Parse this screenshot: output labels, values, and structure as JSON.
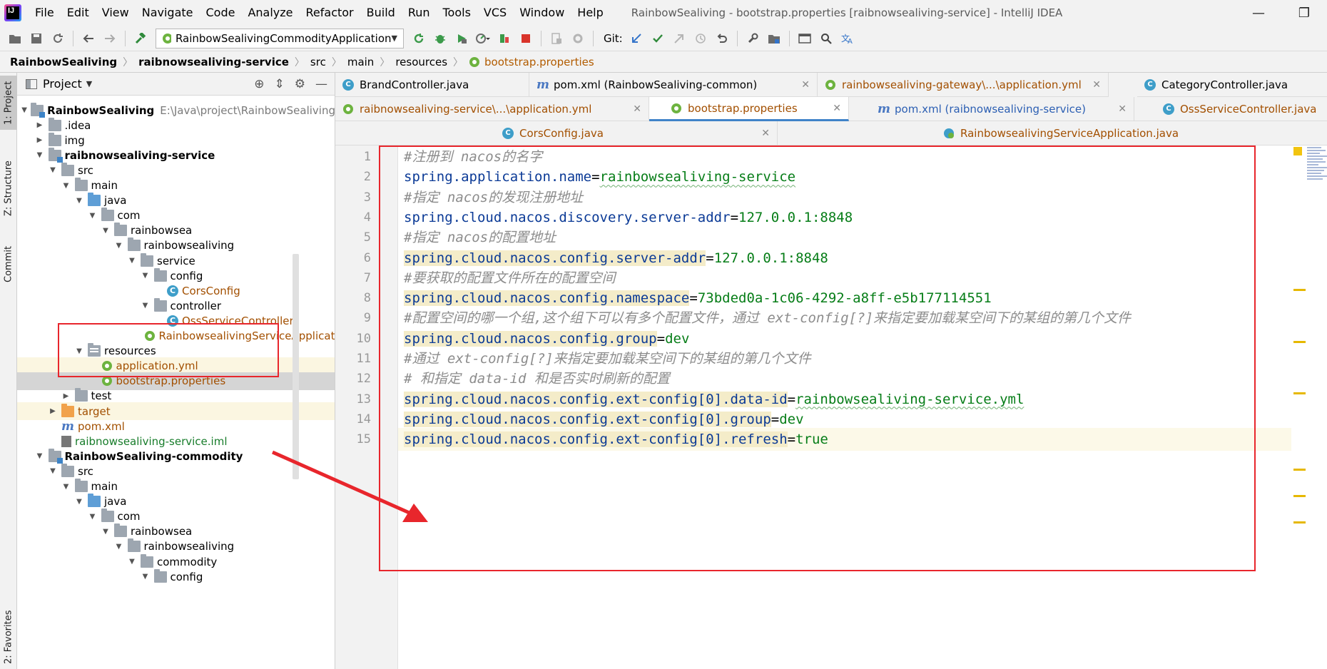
{
  "menu": {
    "items": [
      "File",
      "Edit",
      "View",
      "Navigate",
      "Code",
      "Analyze",
      "Refactor",
      "Build",
      "Run",
      "Tools",
      "VCS",
      "Window",
      "Help"
    ],
    "window_title": "RainbowSealiving - bootstrap.properties [raibnowsealiving-service] - IntelliJ IDEA",
    "minimize": "—",
    "restore": "❐"
  },
  "toolbar": {
    "run_config": "RainbowSealivingCommodityApplication",
    "git_label": "Git:"
  },
  "breadcrumb": {
    "items": [
      "RainbowSealiving",
      "raibnowsealiving-service",
      "src",
      "main",
      "resources",
      "bootstrap.properties"
    ]
  },
  "stripe": {
    "project": "1: Project",
    "structure": "Z: Structure",
    "commit": "Commit",
    "favorites": "2: Favorites"
  },
  "project_panel": {
    "title": "Project",
    "tree": [
      {
        "label": "RainbowSealiving",
        "path": "E:\\Java\\project\\RainbowSealiving"
      },
      {
        "label": ".idea"
      },
      {
        "label": "img"
      },
      {
        "label": "raibnowsealiving-service"
      },
      {
        "label": "src"
      },
      {
        "label": "main"
      },
      {
        "label": "java"
      },
      {
        "label": "com"
      },
      {
        "label": "rainbowsea"
      },
      {
        "label": "rainbowsealiving"
      },
      {
        "label": "service"
      },
      {
        "label": "config"
      },
      {
        "label": "CorsConfig"
      },
      {
        "label": "controller"
      },
      {
        "label": "OssServiceController"
      },
      {
        "label": "RainbowsealivingServiceApplication"
      },
      {
        "label": "resources"
      },
      {
        "label": "application.yml"
      },
      {
        "label": "bootstrap.properties"
      },
      {
        "label": "test"
      },
      {
        "label": "target"
      },
      {
        "label": "pom.xml"
      },
      {
        "label": "raibnowsealiving-service.iml"
      },
      {
        "label": "RainbowSealiving-commodity"
      },
      {
        "label": "src"
      },
      {
        "label": "main"
      },
      {
        "label": "java"
      },
      {
        "label": "com"
      },
      {
        "label": "rainbowsea"
      },
      {
        "label": "rainbowsealiving"
      },
      {
        "label": "commodity"
      },
      {
        "label": "config"
      }
    ]
  },
  "tabs": {
    "row1": [
      "BrandController.java",
      "pom.xml (RainbowSealiving-common)",
      "rainbowsealiving-gateway\\...\\application.yml",
      "CategoryController.java"
    ],
    "row2": [
      "raibnowsealiving-service\\...\\application.yml",
      "bootstrap.properties",
      "pom.xml (raibnowsealiving-service)",
      "OssServiceController.java"
    ],
    "row3": [
      "CorsConfig.java",
      "RainbowsealivingServiceApplication.java"
    ]
  },
  "editor": {
    "lines": [
      {
        "n": "1",
        "type": "comment",
        "text": "#注册到 nacos的名字"
      },
      {
        "n": "2",
        "type": "prop",
        "key": "spring.application.name",
        "value": "rainbowsealiving-service"
      },
      {
        "n": "3",
        "type": "comment",
        "text": "#指定 nacos的发现注册地址"
      },
      {
        "n": "4",
        "type": "prop",
        "key": "spring.cloud.nacos.discovery.server-addr",
        "value": "127.0.0.1:8848"
      },
      {
        "n": "5",
        "type": "comment",
        "text": "#指定 nacos的配置地址"
      },
      {
        "n": "6",
        "type": "prop",
        "key": "spring.cloud.nacos.config.server-addr",
        "value": "127.0.0.1:8848"
      },
      {
        "n": "7",
        "type": "comment",
        "text": "#要获取的配置文件所在的配置空间"
      },
      {
        "n": "8",
        "type": "prop",
        "key": "spring.cloud.nacos.config.namespace",
        "value": "73bded0a-1c06-4292-a8ff-e5b177114551"
      },
      {
        "n": "9",
        "type": "comment",
        "text": "#配置空间的哪一个组,这个组下可以有多个配置文件，通过 ext-config[?]来指定要加载某空间下的某组的第几个文件"
      },
      {
        "n": "10",
        "type": "prop",
        "key": "spring.cloud.nacos.config.group",
        "value": "dev"
      },
      {
        "n": "11",
        "type": "comment",
        "text": "#通过 ext-config[?]来指定要加载某空间下的某组的第几个文件"
      },
      {
        "n": "12",
        "type": "comment",
        "text": "# 和指定 data-id 和是否实时刷新的配置"
      },
      {
        "n": "13",
        "type": "prop",
        "key": "spring.cloud.nacos.config.ext-config[0].data-id",
        "value": "rainbowsealiving-service.yml"
      },
      {
        "n": "14",
        "type": "prop",
        "key": "spring.cloud.nacos.config.ext-config[0].group",
        "value": "dev"
      },
      {
        "n": "15",
        "type": "prop",
        "key": "spring.cloud.nacos.config.ext-config[0].refresh",
        "value": "true"
      }
    ]
  },
  "colors": {
    "annotation_red": "#e8262c",
    "active_tab_underline": "#4083c9"
  }
}
